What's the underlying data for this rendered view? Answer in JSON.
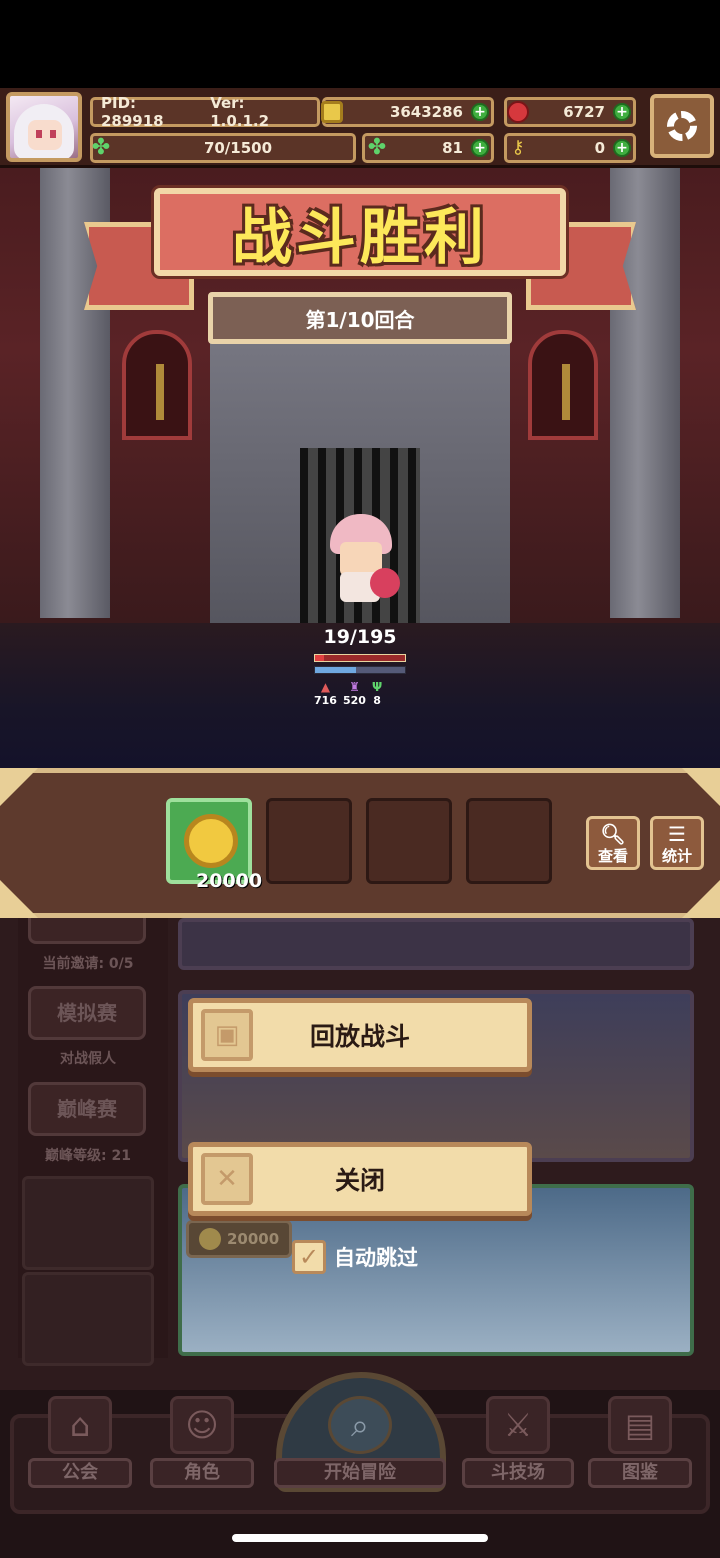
{
  "hud": {
    "pid": "PID: 289918",
    "version": "Ver: 1.0.1.2",
    "gold": "3643286",
    "gems": "6727",
    "exp": "70/1500",
    "clover": "81",
    "keys": "0"
  },
  "battle": {
    "title": "战斗胜利",
    "round": "第1/10回合",
    "hp": "19/195",
    "hp_fraction": 0.1,
    "mp_fraction": 0.45,
    "stats": {
      "attack": "716",
      "magic": "520",
      "speed": "8"
    }
  },
  "rewards": {
    "items": [
      {
        "icon": "gold-coin-icon",
        "qty": "20000"
      }
    ],
    "view_label": "查看",
    "stats_label": "统计"
  },
  "arena_left": {
    "current_invites": "当前邀请: 0/5",
    "sim_label": "模拟赛",
    "sim_sub": "对战假人",
    "peak_label": "巅峰赛",
    "peak_sub": "巅峰等级: 21"
  },
  "dialog": {
    "replay_label": "回放战斗",
    "close_label": "关闭",
    "auto_skip_label": "自动跳过",
    "entry_cost": "20000"
  },
  "nav": {
    "guild": "公会",
    "role": "角色",
    "adventure": "开始冒险",
    "arena": "斗技场",
    "codex": "图鉴"
  },
  "colors": {
    "title_yellow": "#fde85a",
    "banner_red": "#dc6e62",
    "button_cream": "#f2dcaa"
  }
}
